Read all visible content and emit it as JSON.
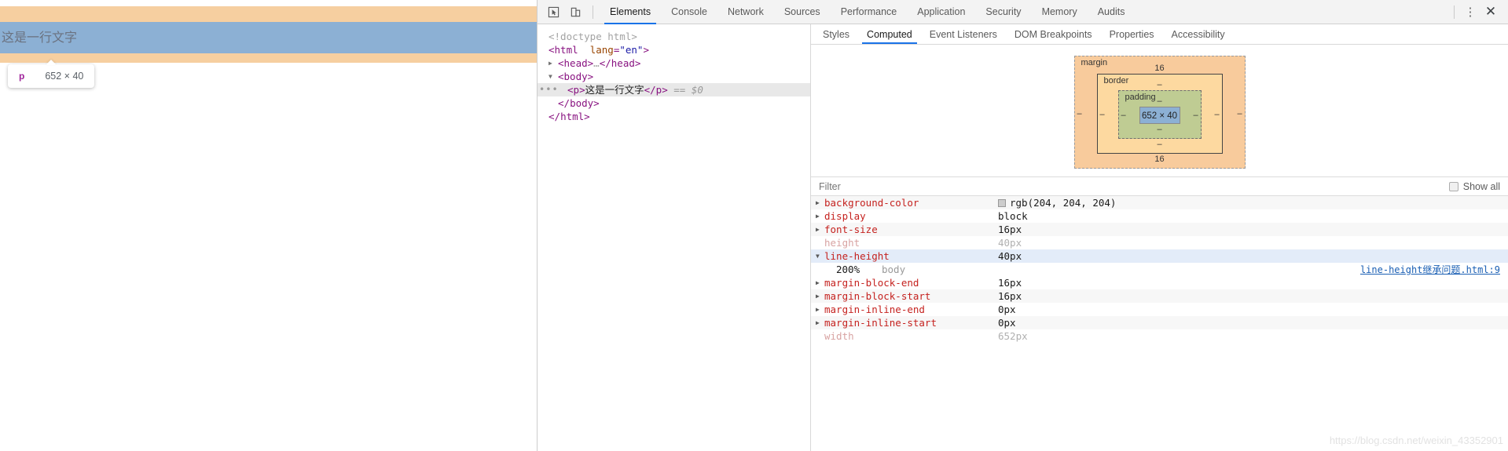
{
  "page": {
    "highlighted_text": "这是一行文字",
    "tooltip": {
      "tag": "p",
      "dimensions": "652 × 40"
    },
    "colors": {
      "margin_highlight": "#f6cfa0",
      "content_highlight": "#8cb0d4"
    }
  },
  "devtools": {
    "toolbar": {
      "inspect_icon": "inspect-cursor-icon",
      "device_icon": "device-toolbar-icon",
      "kebab_label": "⋮",
      "close_label": "✕",
      "tabs": [
        {
          "label": "Elements",
          "active": true
        },
        {
          "label": "Console",
          "active": false
        },
        {
          "label": "Network",
          "active": false
        },
        {
          "label": "Sources",
          "active": false
        },
        {
          "label": "Performance",
          "active": false
        },
        {
          "label": "Application",
          "active": false
        },
        {
          "label": "Security",
          "active": false
        },
        {
          "label": "Memory",
          "active": false
        },
        {
          "label": "Audits",
          "active": false
        }
      ]
    },
    "dom": {
      "lines": [
        {
          "id": "doctype",
          "text": "<!doctype html>"
        },
        {
          "id": "html-open",
          "text": "<html lang=\"en\">"
        },
        {
          "id": "head",
          "text": "<head>…</head>"
        },
        {
          "id": "body-open",
          "text": "<body>"
        },
        {
          "id": "p-node",
          "text": "<p>这是一行文字</p>",
          "suffix": "== $0"
        },
        {
          "id": "body-close",
          "text": "</body>"
        },
        {
          "id": "html-close",
          "text": "</html>"
        }
      ]
    },
    "sidebar": {
      "tabs": [
        {
          "label": "Styles",
          "active": false
        },
        {
          "label": "Computed",
          "active": true
        },
        {
          "label": "Event Listeners",
          "active": false
        },
        {
          "label": "DOM Breakpoints",
          "active": false
        },
        {
          "label": "Properties",
          "active": false
        },
        {
          "label": "Accessibility",
          "active": false
        }
      ],
      "box_model": {
        "margin_label": "margin",
        "margin_top": "16",
        "margin_bottom": "16",
        "margin_left": "–",
        "margin_right": "–",
        "border_label": "border",
        "border_top": "–",
        "border_bottom": "–",
        "border_left": "–",
        "border_right": "–",
        "padding_label": "padding",
        "padding_top": "–",
        "padding_bottom": "–",
        "padding_left": "–",
        "padding_right": "–",
        "content_size": "652 × 40"
      },
      "filter": {
        "placeholder": "Filter",
        "value": "",
        "show_all_label": "Show all",
        "show_all_checked": false
      },
      "properties": [
        {
          "name": "background-color",
          "value": "rgb(204, 204, 204)",
          "swatch": "#cccccc",
          "expandable": true,
          "expanded": false,
          "inherited": false,
          "selected": false
        },
        {
          "name": "display",
          "value": "block",
          "expandable": true,
          "expanded": false,
          "inherited": false,
          "selected": false
        },
        {
          "name": "font-size",
          "value": "16px",
          "expandable": true,
          "expanded": false,
          "inherited": false,
          "selected": false
        },
        {
          "name": "height",
          "value": "40px",
          "expandable": false,
          "expanded": false,
          "inherited": true,
          "selected": false
        },
        {
          "name": "line-height",
          "value": "40px",
          "expandable": true,
          "expanded": true,
          "inherited": false,
          "selected": true,
          "children": [
            {
              "value": "200%",
              "source": "body",
              "link": "line-height继承问题.html:9"
            }
          ]
        },
        {
          "name": "margin-block-end",
          "value": "16px",
          "expandable": true,
          "expanded": false,
          "inherited": false,
          "selected": false
        },
        {
          "name": "margin-block-start",
          "value": "16px",
          "expandable": true,
          "expanded": false,
          "inherited": false,
          "selected": false
        },
        {
          "name": "margin-inline-end",
          "value": "0px",
          "expandable": true,
          "expanded": false,
          "inherited": false,
          "selected": false
        },
        {
          "name": "margin-inline-start",
          "value": "0px",
          "expandable": true,
          "expanded": false,
          "inherited": false,
          "selected": false
        },
        {
          "name": "width",
          "value": "652px",
          "expandable": false,
          "expanded": false,
          "inherited": true,
          "selected": false
        }
      ]
    }
  },
  "watermark": "https://blog.csdn.net/weixin_43352901"
}
